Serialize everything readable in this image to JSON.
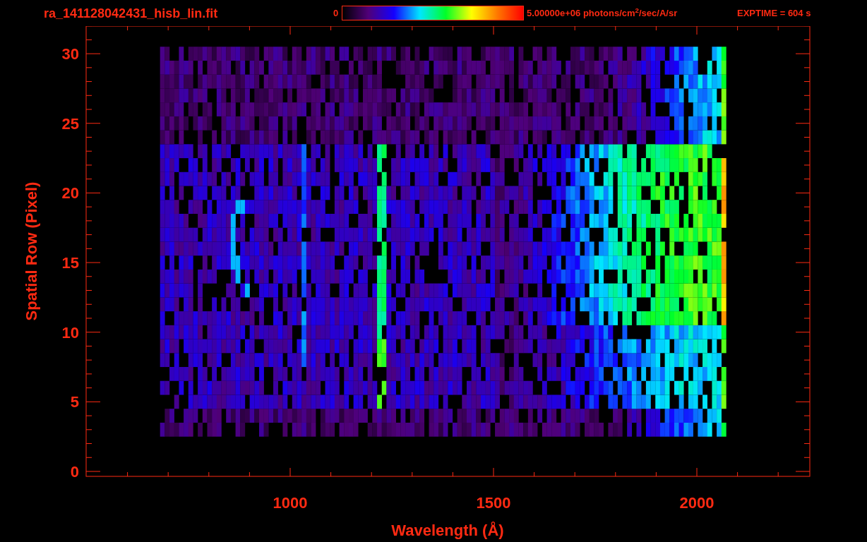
{
  "title": "ra_141128042431_hisb_lin.fit",
  "colorbar": {
    "min_label": "0",
    "max_label": "5.00000e+06 photons/cm$^{2}$/sec/A/sr"
  },
  "exposure": "EXPTIME = 604 s",
  "x_axis": {
    "label": "Wavelength (Å)",
    "ticks": [
      "1000",
      "1500",
      "2000"
    ]
  },
  "y_axis": {
    "label": "Spatial Row (Pixel)",
    "ticks": [
      "30",
      "25",
      "20",
      "15",
      "10",
      "5",
      "0"
    ]
  }
}
